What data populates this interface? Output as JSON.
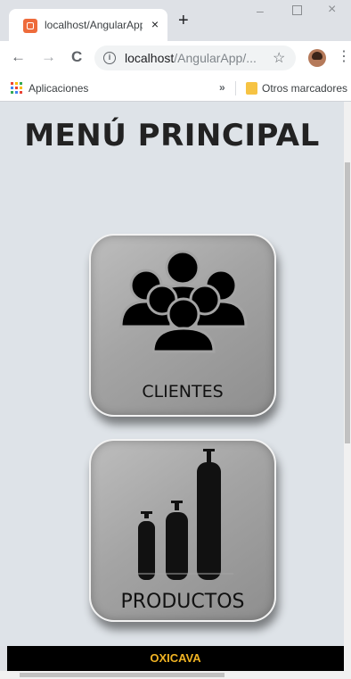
{
  "browser": {
    "tab_title": "localhost/AngularApp",
    "tab_close": "×",
    "new_tab": "+",
    "url_host": "localhost",
    "url_path": "/AngularApp/...",
    "bookmarks": {
      "apps": "Aplicaciones",
      "more": "»",
      "other": "Otros marcadores"
    },
    "icons": {
      "favicon": "xampp-icon",
      "back": "←",
      "forward": "→",
      "reload": "C",
      "info": "i",
      "star": "☆",
      "menu": "⋮",
      "minimize": "–",
      "close": "×"
    }
  },
  "page": {
    "title": "MENÚ PRINCIPAL",
    "menu_items": [
      {
        "label": "CLIENTES",
        "icon": "people-icon"
      },
      {
        "label": "PRODUCTOS",
        "icon": "gas-cylinders-icon"
      }
    ],
    "footer": "OXICAVA"
  },
  "colors": {
    "page_bg": "#dee3e8",
    "card_bg": "#a4a4a4",
    "footer_bg": "#000000",
    "footer_text": "#f0b323"
  }
}
